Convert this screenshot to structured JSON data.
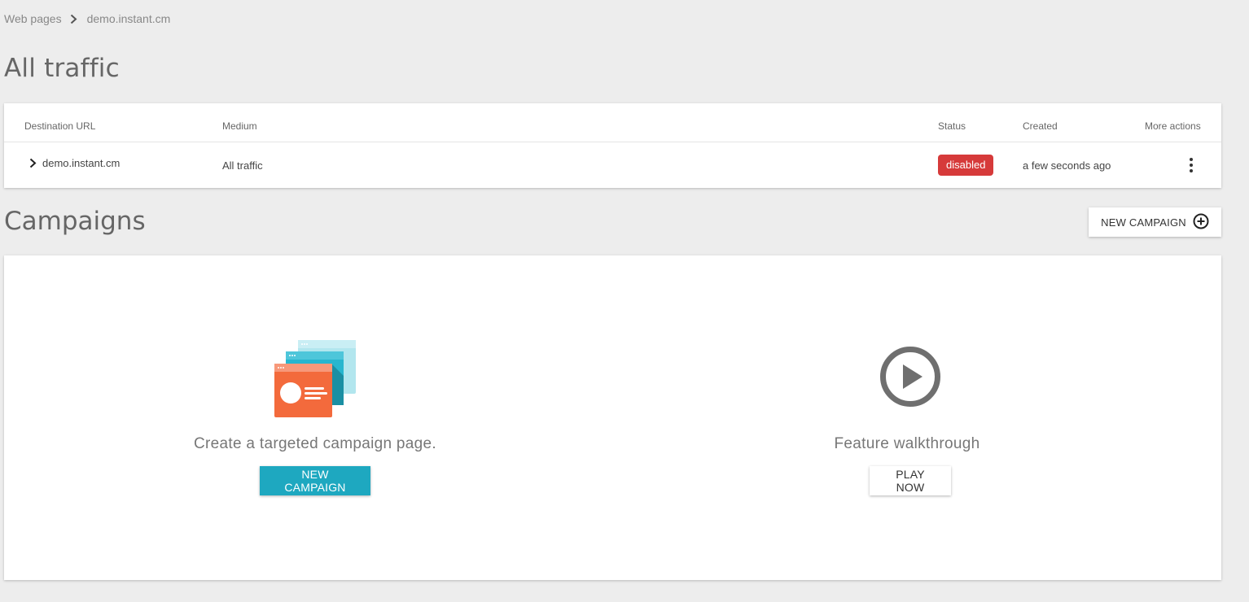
{
  "breadcrumb": {
    "parent": "Web pages",
    "current": "demo.instant.cm",
    "separator_icon": "chevron-right-icon"
  },
  "traffic_section": {
    "title": "All traffic",
    "columns": {
      "destination": "Destination URL",
      "medium": "Medium",
      "status": "Status",
      "created": "Created",
      "actions": "More actions"
    },
    "rows": [
      {
        "destination": "demo.instant.cm",
        "medium": "All traffic",
        "status": "disabled",
        "created": "a few seconds ago"
      }
    ]
  },
  "campaigns_section": {
    "title": "Campaigns",
    "new_campaign_button": "NEW CAMPAIGN",
    "new_campaign_icon": "add-circle-icon",
    "promo_left": {
      "text": "Create a targeted campaign page.",
      "button": "NEW CAMPAIGN",
      "icon": "campaign-pages-illustration"
    },
    "promo_right": {
      "text": "Feature walkthrough",
      "button": "PLAY NOW",
      "icon": "play-circle-icon"
    }
  },
  "colors": {
    "background": "#ededed",
    "primary": "#1ea8c0",
    "status_disabled": "#d63a3a",
    "illustration_orange": "#f36a3c",
    "illustration_cyan": "#27b6cf",
    "illustration_light_cyan": "#b2e6ee"
  }
}
